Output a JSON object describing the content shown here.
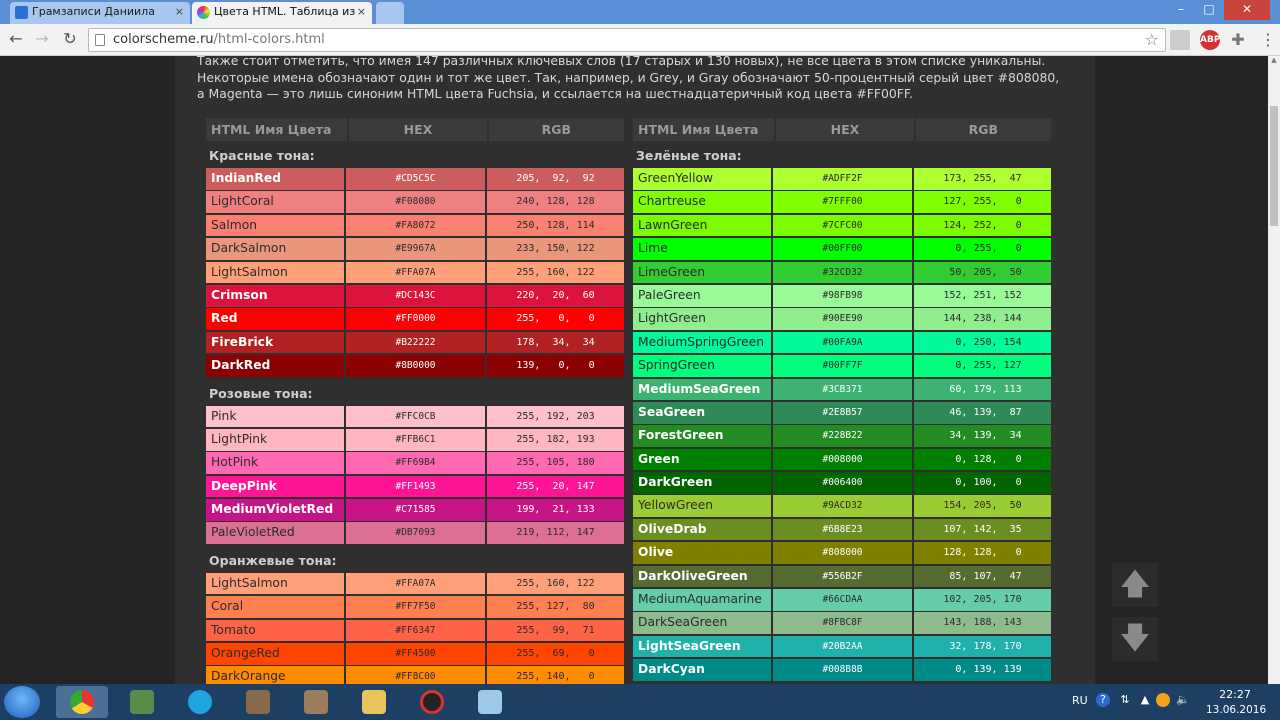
{
  "browser": {
    "tabs": [
      {
        "title": "Грамзаписи Даниила",
        "audio_icon": "🔊",
        "close": "×"
      },
      {
        "title": "Цвета HTML. Таблица из",
        "close": "×"
      }
    ],
    "url_domain": "colorscheme.ru",
    "url_path": "/html-colors.html",
    "abp_label": "ABP"
  },
  "page": {
    "intro": "Также стоит отметить, что имея 147 различных ключевых слов (17 старых и 130 новых), не все цвета в этом списке уникальны. Некоторые имена обозначают один и тот же цвет. Так, например, и Grey, и Gray обозначают 50-процентный серый цвет #808080, а Magenta — это лишь синоним HTML цвета Fuchsia, и ссылается на шестнадцатеричный код цвета #FF00FF.",
    "headers": {
      "name": "HTML Имя Цвета",
      "hex": "HEX",
      "rgb": "RGB"
    },
    "left_groups": [
      {
        "title": "Красные тона:",
        "rows": [
          {
            "name": "IndianRed",
            "hex": "#CD5C5C",
            "rgb": "205,  92,  92",
            "dark": true
          },
          {
            "name": "LightCoral",
            "hex": "#F08080",
            "rgb": "240, 128, 128",
            "dark": false
          },
          {
            "name": "Salmon",
            "hex": "#FA8072",
            "rgb": "250, 128, 114",
            "dark": false
          },
          {
            "name": "DarkSalmon",
            "hex": "#E9967A",
            "rgb": "233, 150, 122",
            "dark": false
          },
          {
            "name": "LightSalmon",
            "hex": "#FFA07A",
            "rgb": "255, 160, 122",
            "dark": false
          },
          {
            "name": "Crimson",
            "hex": "#DC143C",
            "rgb": "220,  20,  60",
            "dark": true
          },
          {
            "name": "Red",
            "hex": "#FF0000",
            "rgb": "255,   0,   0",
            "dark": true
          },
          {
            "name": "FireBrick",
            "hex": "#B22222",
            "rgb": "178,  34,  34",
            "dark": true
          },
          {
            "name": "DarkRed",
            "hex": "#8B0000",
            "rgb": "139,   0,   0",
            "dark": true
          }
        ]
      },
      {
        "title": "Розовые тона:",
        "rows": [
          {
            "name": "Pink",
            "hex": "#FFC0CB",
            "rgb": "255, 192, 203",
            "dark": false
          },
          {
            "name": "LightPink",
            "hex": "#FFB6C1",
            "rgb": "255, 182, 193",
            "dark": false
          },
          {
            "name": "HotPink",
            "hex": "#FF69B4",
            "rgb": "255, 105, 180",
            "dark": false
          },
          {
            "name": "DeepPink",
            "hex": "#FF1493",
            "rgb": "255,  20, 147",
            "dark": true
          },
          {
            "name": "MediumVioletRed",
            "hex": "#C71585",
            "rgb": "199,  21, 133",
            "dark": true
          },
          {
            "name": "PaleVioletRed",
            "hex": "#DB7093",
            "rgb": "219, 112, 147",
            "dark": false
          }
        ]
      },
      {
        "title": "Оранжевые тона:",
        "rows": [
          {
            "name": "LightSalmon",
            "hex": "#FFA07A",
            "rgb": "255, 160, 122",
            "dark": false
          },
          {
            "name": "Coral",
            "hex": "#FF7F50",
            "rgb": "255, 127,  80",
            "dark": false
          },
          {
            "name": "Tomato",
            "hex": "#FF6347",
            "rgb": "255,  99,  71",
            "dark": false
          },
          {
            "name": "OrangeRed",
            "hex": "#FF4500",
            "rgb": "255,  69,   0",
            "dark": false
          },
          {
            "name": "DarkOrange",
            "hex": "#FF8C00",
            "rgb": "255, 140,   0",
            "dark": false
          }
        ]
      }
    ],
    "right_groups": [
      {
        "title": "Зелёные тона:",
        "rows": [
          {
            "name": "GreenYellow",
            "hex": "#ADFF2F",
            "rgb": "173, 255,  47",
            "dark": false
          },
          {
            "name": "Chartreuse",
            "hex": "#7FFF00",
            "rgb": "127, 255,   0",
            "dark": false
          },
          {
            "name": "LawnGreen",
            "hex": "#7CFC00",
            "rgb": "124, 252,   0",
            "dark": false
          },
          {
            "name": "Lime",
            "hex": "#00FF00",
            "rgb": "  0, 255,   0",
            "dark": false
          },
          {
            "name": "LimeGreen",
            "hex": "#32CD32",
            "rgb": " 50, 205,  50",
            "dark": false
          },
          {
            "name": "PaleGreen",
            "hex": "#98FB98",
            "rgb": "152, 251, 152",
            "dark": false
          },
          {
            "name": "LightGreen",
            "hex": "#90EE90",
            "rgb": "144, 238, 144",
            "dark": false
          },
          {
            "name": "MediumSpringGreen",
            "hex": "#00FA9A",
            "rgb": "  0, 250, 154",
            "dark": false
          },
          {
            "name": "SpringGreen",
            "hex": "#00FF7F",
            "rgb": "  0, 255, 127",
            "dark": false
          },
          {
            "name": "MediumSeaGreen",
            "hex": "#3CB371",
            "rgb": " 60, 179, 113",
            "dark": true
          },
          {
            "name": "SeaGreen",
            "hex": "#2E8B57",
            "rgb": " 46, 139,  87",
            "dark": true
          },
          {
            "name": "ForestGreen",
            "hex": "#228B22",
            "rgb": " 34, 139,  34",
            "dark": true
          },
          {
            "name": "Green",
            "hex": "#008000",
            "rgb": "  0, 128,   0",
            "dark": true
          },
          {
            "name": "DarkGreen",
            "hex": "#006400",
            "rgb": "  0, 100,   0",
            "dark": true
          },
          {
            "name": "YellowGreen",
            "hex": "#9ACD32",
            "rgb": "154, 205,  50",
            "dark": false
          },
          {
            "name": "OliveDrab",
            "hex": "#6B8E23",
            "rgb": "107, 142,  35",
            "dark": true
          },
          {
            "name": "Olive",
            "hex": "#808000",
            "rgb": "128, 128,   0",
            "dark": true
          },
          {
            "name": "DarkOliveGreen",
            "hex": "#556B2F",
            "rgb": " 85, 107,  47",
            "dark": true
          },
          {
            "name": "MediumAquamarine",
            "hex": "#66CDAA",
            "rgb": "102, 205, 170",
            "dark": false
          },
          {
            "name": "DarkSeaGreen",
            "hex": "#8FBC8F",
            "rgb": "143, 188, 143",
            "dark": false
          },
          {
            "name": "LightSeaGreen",
            "hex": "#20B2AA",
            "rgb": " 32, 178, 170",
            "dark": true
          },
          {
            "name": "DarkCyan",
            "hex": "#008B8B",
            "rgb": "  0, 139, 139",
            "dark": true
          }
        ]
      }
    ],
    "scroll_up_glyph": "🡅",
    "scroll_down_glyph": "🡇"
  },
  "taskbar": {
    "lang": "RU",
    "time": "22:27",
    "date": "13.06.2016"
  }
}
